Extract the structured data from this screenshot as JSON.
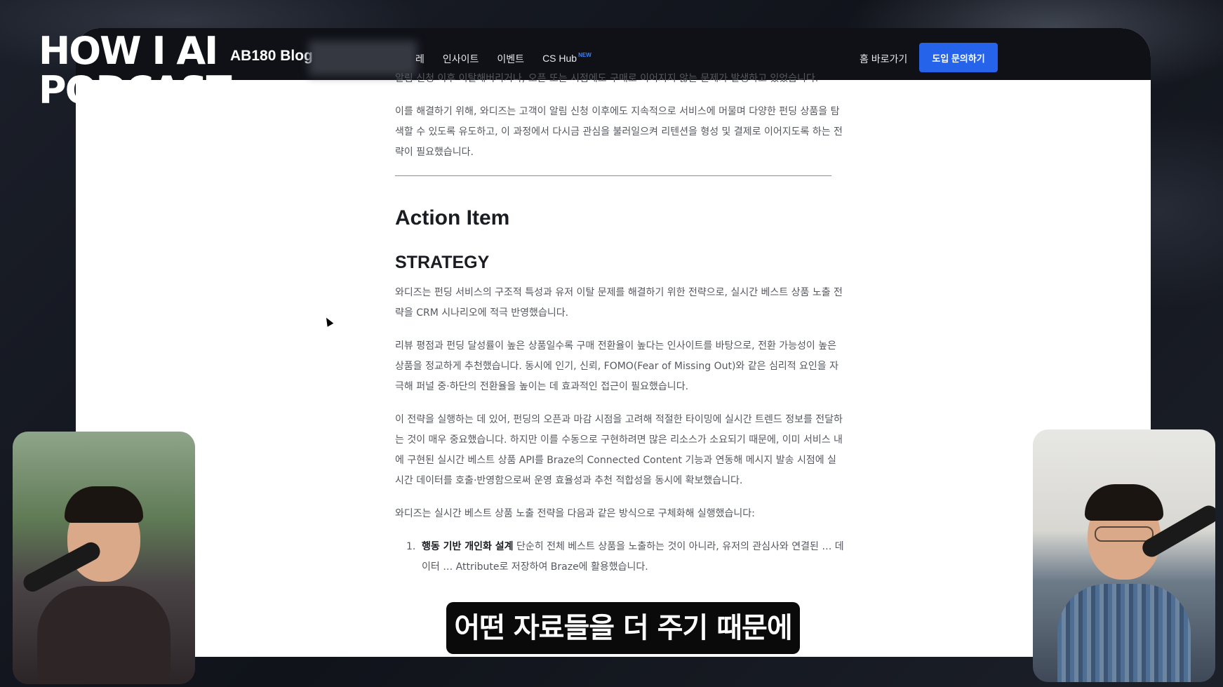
{
  "overlay": {
    "podcast_logo_line1": "HOW I AI",
    "podcast_logo_line2": "PODCAST",
    "subtitle": "어떤 자료들을 더 주기 때문에"
  },
  "nav": {
    "brand": "AB180 Blog",
    "items": [
      {
        "label": "레"
      },
      {
        "label": "인사이트"
      },
      {
        "label": "이벤트"
      },
      {
        "label": "CS Hub",
        "badge": "NEW"
      }
    ],
    "home_link": "홈 바로가기",
    "cta": "도입 문의하기",
    "cta_color": "#2563eb"
  },
  "article": {
    "intro_cut": "알림 신청 이후 이탈해버리거나, 오픈 또는 시점에도 구매로 이어지지 않는 문제가 발생하고 있었습니다.",
    "intro": "이를 해결하기 위해, 와디즈는 고객이 알림 신청 이후에도 지속적으로 서비스에 머물며 다양한 펀딩 상품을 탐색할 수 있도록 유도하고, 이 과정에서 다시금 관심을 불러일으켜 리텐션을 형성 및 결제로 이어지도록 하는 전략이 필요했습니다.",
    "heading": "Action Item",
    "subheading": "STRATEGY",
    "paragraphs": [
      "와디즈는 펀딩 서비스의 구조적 특성과 유저 이탈 문제를 해결하기 위한 전략으로, 실시간 베스트 상품 노출 전략을 CRM 시나리오에 적극 반영했습니다.",
      "리뷰 평점과 펀딩 달성률이 높은 상품일수록 구매 전환율이 높다는 인사이트를 바탕으로, 전환 가능성이 높은 상품을 정교하게 추천했습니다. 동시에 인기, 신뢰, FOMO(Fear of Missing Out)와 같은 심리적 요인을 자극해 퍼널 중·하단의 전환율을 높이는 데 효과적인 접근이 필요했습니다.",
      "이 전략을 실행하는 데 있어, 펀딩의 오픈과 마감 시점을 고려해 적절한 타이밍에 실시간 트렌드 정보를 전달하는 것이 매우 중요했습니다. 하지만 이를 수동으로 구현하려면 많은 리소스가 소요되기 때문에, 이미 서비스 내에 구현된 실시간 베스트 상품 API를 Braze의 Connected Content 기능과 연동해 메시지 발송 시점에 실시간 데이터를 호출·반영함으로써 운영 효율성과 추천 적합성을 동시에 확보했습니다.",
      "와디즈는 실시간 베스트 상품 노출 전략을 다음과 같은 방식으로 구체화해 실행했습니다:"
    ],
    "list_items": [
      {
        "num": "1.",
        "bold": "행동 기반 개인화 설계",
        "text": " 단순히 전체 베스트 상품을 노출하는 것이 아니라, 유저의 관심사와 연결된 … 데이터 … Attribute로 저장하여 Braze에 활용했습니다."
      }
    ]
  }
}
